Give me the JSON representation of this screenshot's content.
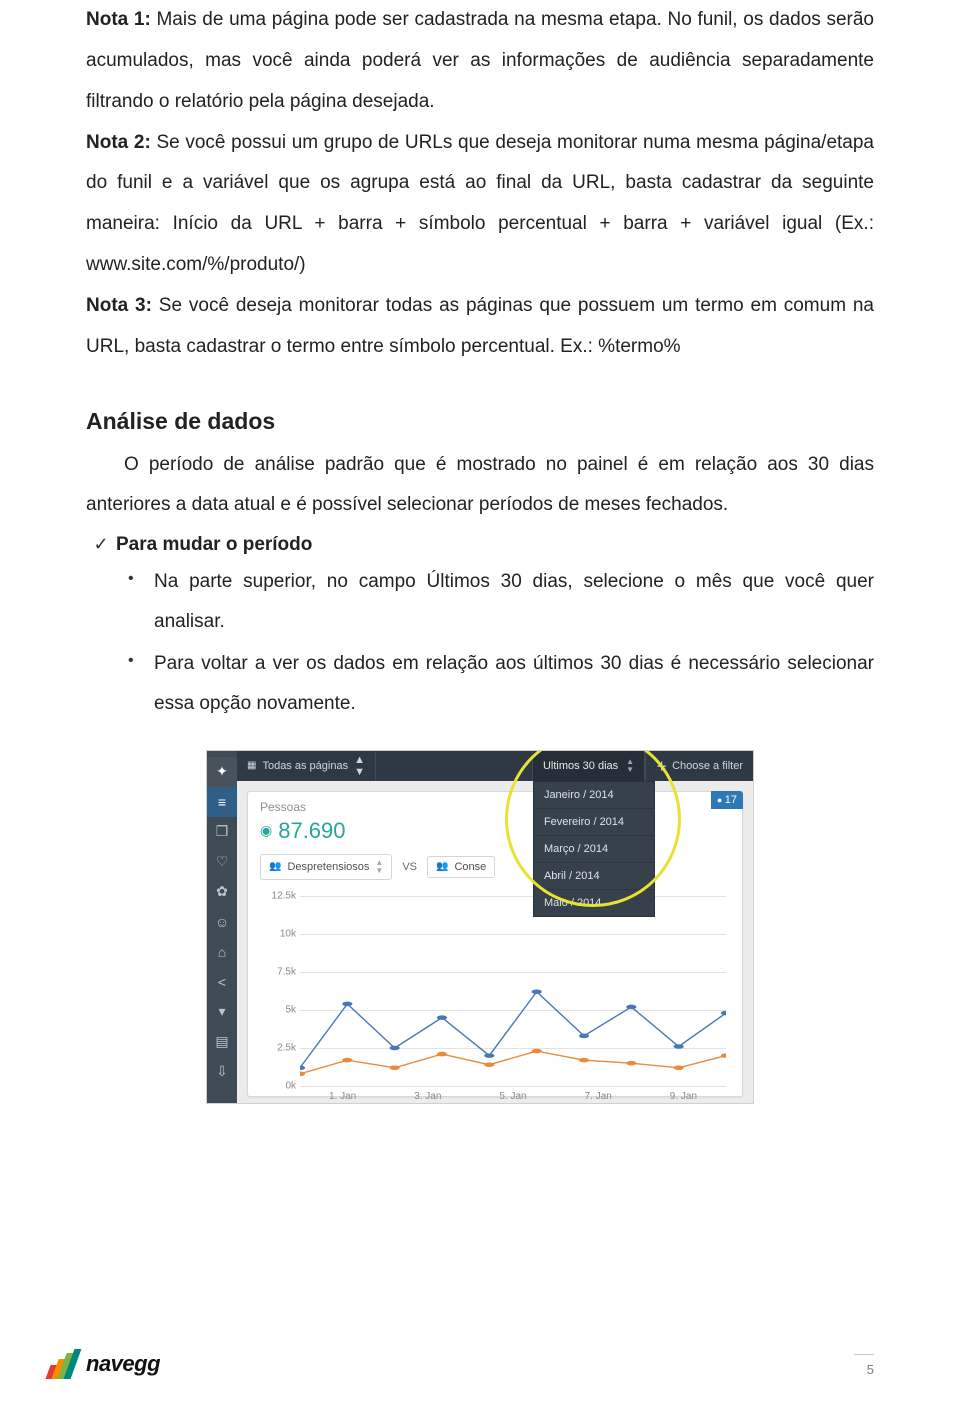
{
  "notes": {
    "nota1_label": "Nota 1:",
    "nota1_text": " Mais de uma página pode ser cadastrada na mesma etapa. No funil, os dados serão acumulados, mas você ainda poderá ver as informações de audiência separadamente filtrando o relatório pela página desejada.",
    "nota2_label": "Nota 2:",
    "nota2_text": " Se você possui um grupo de URLs que deseja monitorar numa mesma página/etapa do funil e a variável que os agrupa está ao final da URL, basta cadastrar da seguinte maneira: Início da URL + barra + símbolo percentual + barra + variável igual (Ex.: www.site.com/%/produto/)",
    "nota3_label": "Nota 3:",
    "nota3_text": " Se você deseja monitorar todas as páginas que possuem um termo em comum na URL, basta cadastrar o termo entre símbolo percentual. Ex.: %termo%"
  },
  "section_title": "Análise de dados",
  "section_body1": "O período de análise padrão que é mostrado no painel é em relação aos 30 dias anteriores a data atual e é possível selecionar períodos de meses fechados.",
  "checklist": {
    "item1": "Para mudar o período"
  },
  "bullets": {
    "b1_a": "Na parte superior, no campo ",
    "b1_bold": "Últimos 30 dias",
    "b1_b": ", selecione o mês que você quer analisar.",
    "b2": "Para voltar a ver os dados em relação aos últimos 30 dias é necessário selecionar essa opção novamente."
  },
  "embed": {
    "pages_label": "Todas as páginas",
    "selector_label": "Ultimos 30 dias",
    "filter_label": "Choose a filter",
    "dropdown": [
      "Janeiro / 2014",
      "Fevereiro / 2014",
      "Março / 2014",
      "Abril / 2014",
      "Maio / 2014"
    ],
    "pessoas_label": "Pessoas",
    "pessoas_value": "87.690",
    "badge": "17",
    "vs_left": "Despretensiosos",
    "vs_mid": "VS",
    "vs_right": "Conse"
  },
  "chart_data": {
    "type": "line",
    "ylim": [
      0,
      12500
    ],
    "y_ticks": [
      "12.5k",
      "10k",
      "7.5k",
      "5k",
      "2.5k",
      "0k"
    ],
    "x_labels": [
      "1. Jan",
      "3. Jan",
      "5. Jan",
      "7. Jan",
      "9. Jan"
    ],
    "series": [
      {
        "name": "Despretensiosos",
        "color": "#4a77b4",
        "values": [
          1200,
          5400,
          2500,
          4500,
          2000,
          6200,
          3300,
          5200,
          2600,
          4800
        ]
      },
      {
        "name": "Conse",
        "color": "#e98b3a",
        "values": [
          800,
          1700,
          1200,
          2100,
          1400,
          2300,
          1700,
          1500,
          1200,
          2000
        ]
      }
    ]
  },
  "footer": {
    "brand": "navegg",
    "page_number": "5"
  }
}
